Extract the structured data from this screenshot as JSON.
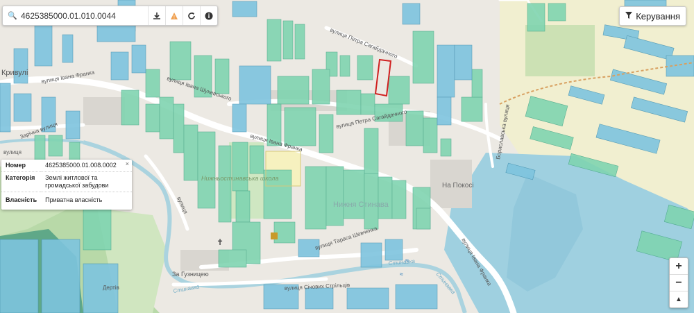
{
  "search": {
    "value": "4625385000.01.010.0044"
  },
  "toolbar": {
    "download_icon": "download-icon",
    "warning_icon": "warning-icon",
    "refresh_icon": "refresh-icon",
    "info_icon": "info-icon"
  },
  "control": {
    "label": "Керування",
    "icon": "filter-icon"
  },
  "popup": {
    "close": "×",
    "rows": [
      {
        "key": "Номер",
        "value": "4625385000.01.008.0002"
      },
      {
        "key": "Категорія",
        "value": "Землі житлової та громадської забудови"
      },
      {
        "key": "Власність",
        "value": "Приватна власність"
      }
    ]
  },
  "zoom": {
    "in": "+",
    "out": "−",
    "north": "▲"
  },
  "map": {
    "labels": {
      "kryvuli": "Кривулі",
      "franka_w": "вулиця Івана Франка",
      "franka_mid": "вулиця Івана Франка",
      "franka_se": "вулиця Івана Франка",
      "shukhevych": "вулиця Івана Шухевського",
      "sahaidachnoho_n": "вулиця Петра Сагайдачного",
      "sahaidachnoho_s": "вулиця Петра Сагайдачного",
      "zarichna": "Зарічна вулиця",
      "boryslavska": "Бориславська вулиця",
      "zhovtneva": "вулиця",
      "school": "Нижньостинавська школа",
      "na_pokosi": "На Покосі",
      "nyzhnia_stynava": "Нижня Стинава",
      "shevchenka": "вулиця Тараса Шевченка",
      "za_huznytseiu": "За Гузницею",
      "sichovykh": "вулиця Січових Стрільців",
      "stynavka1": "Стинавка",
      "stynavka2": "Стинавка",
      "stynavka3": "Стинавка",
      "dertiv": "Дертів",
      "zarichna2": "вулиця",
      "tsentralna": "вулиця"
    }
  },
  "colors": {
    "parcel_green": "#7fd4b0",
    "parcel_blue": "#7ec4de",
    "selected_outline": "#d02020",
    "water": "#aad3df",
    "forest": "#5fae72"
  }
}
